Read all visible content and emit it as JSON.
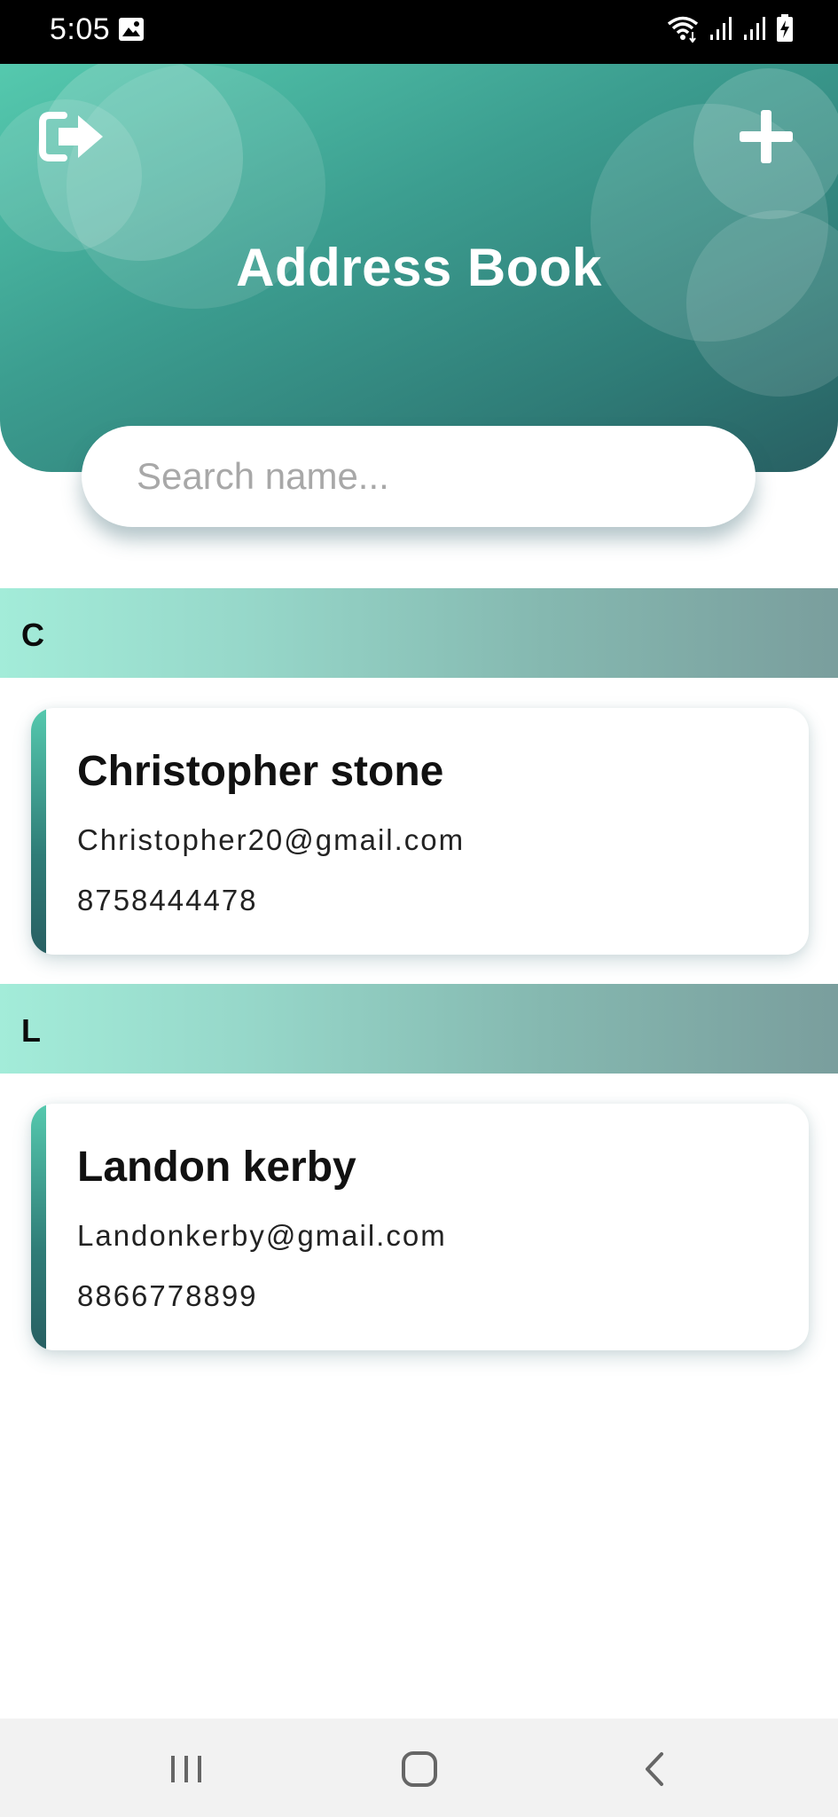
{
  "status_bar": {
    "time": "5:05",
    "icons": [
      "gallery-icon",
      "wifi-icon",
      "signal-icon",
      "signal-icon",
      "battery-charging-icon"
    ]
  },
  "header": {
    "title": "Address Book",
    "logout_icon": "logout-icon",
    "add_icon": "plus-icon",
    "gradient_colors": [
      "#55c9ae",
      "#2f7c77",
      "#285f62"
    ]
  },
  "search": {
    "placeholder": "Search name...",
    "value": ""
  },
  "sections": [
    {
      "letter": "C",
      "contacts": [
        {
          "name": "Christopher stone",
          "email": "Christopher20@gmail.com",
          "phone": "8758444478"
        }
      ]
    },
    {
      "letter": "L",
      "contacts": [
        {
          "name": "Landon kerby",
          "email": "Landonkerby@gmail.com",
          "phone": "8866778899"
        }
      ]
    }
  ],
  "nav_bar": {
    "icons": [
      "recents-icon",
      "home-icon",
      "back-icon"
    ]
  }
}
